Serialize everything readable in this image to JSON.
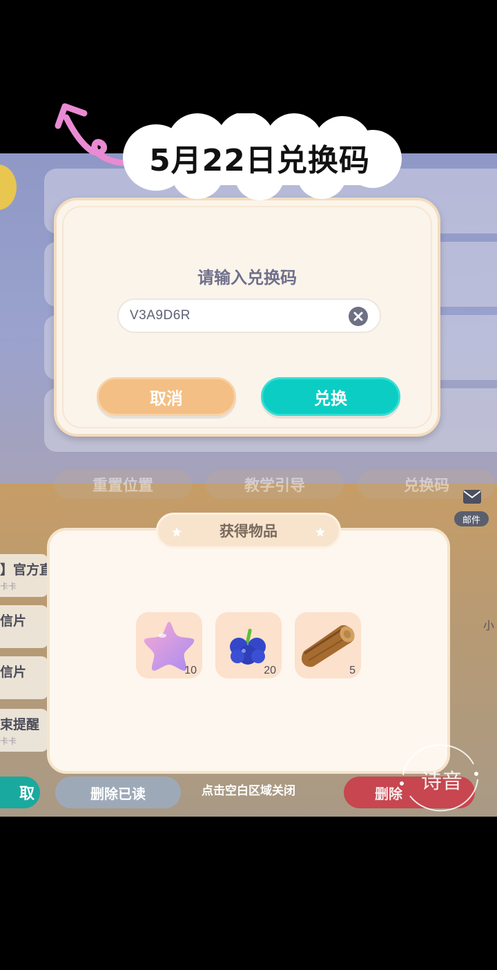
{
  "overlay": {
    "title": "5月22日兑换码"
  },
  "background": {
    "tabs": [
      "重置位置",
      "教学引导",
      "兑换码"
    ],
    "mail_label": "邮件",
    "list": [
      {
        "title": "】官方直",
        "sub": "卡卡"
      },
      {
        "title": "信片",
        "sub": ""
      },
      {
        "title": "信片",
        "sub": ""
      },
      {
        "title": "束提醒",
        "sub": "卡卡"
      }
    ],
    "right_fragment": "小",
    "bottom_left_button": "取",
    "delete_read_button": "删除已读",
    "delete_button": "删除"
  },
  "dialog": {
    "title": "请输入兑换码",
    "code_value": "V3A9D6R",
    "cancel_label": "取消",
    "redeem_label": "兑换"
  },
  "rewards": {
    "title": "获得物品",
    "items": [
      {
        "icon": "pink-star-icon",
        "qty": "10"
      },
      {
        "icon": "blueberry-icon",
        "qty": "20"
      },
      {
        "icon": "wood-log-icon",
        "qty": "5"
      }
    ],
    "close_hint": "点击空白区域关闭"
  },
  "watermark": {
    "text": "诗音"
  },
  "colors": {
    "teal": "#0ccdc4",
    "orange": "#f3bf84",
    "panel": "#fbf4ea",
    "arrow_pink": "#e98bd3"
  }
}
